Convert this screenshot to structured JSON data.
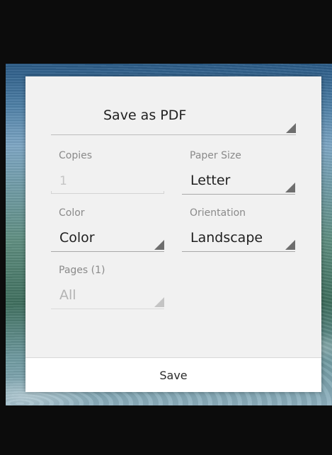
{
  "dialog": {
    "destination": "Save as PDF",
    "copies": {
      "label": "Copies",
      "value": "1"
    },
    "paper_size": {
      "label": "Paper Size",
      "value": "Letter"
    },
    "color": {
      "label": "Color",
      "value": "Color"
    },
    "orientation": {
      "label": "Orientation",
      "value": "Landscape"
    },
    "pages": {
      "label": "Pages (1)",
      "value": "All"
    },
    "save_label": "Save"
  },
  "icons": {
    "dropdown": "dropdown-triangle-icon"
  }
}
